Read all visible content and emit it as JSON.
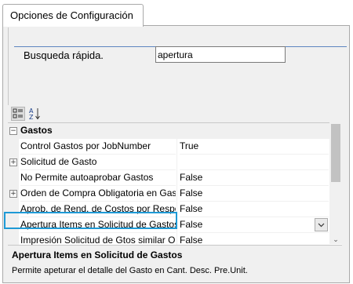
{
  "tab": {
    "title": "Opciones de Configuración"
  },
  "search": {
    "label": "Busqueda rápida.",
    "value": "apertura"
  },
  "toolbar": {
    "categorized_icon": "categorized-view-icon",
    "alphabetical_icon": "alphabetical-sort-icon"
  },
  "grid": {
    "category": "Gastos",
    "rows": [
      {
        "name": "Control Gastos por JobNumber",
        "value": "True",
        "expandable": false
      },
      {
        "name": "Solicitud de Gasto",
        "value": "",
        "expandable": true
      },
      {
        "name": "No Permite autoaprobar Gastos",
        "value": "False",
        "expandable": false
      },
      {
        "name": "Orden de Compra Obligatoria en Gastos",
        "value": "False",
        "expandable": true
      },
      {
        "name": "Aprob. de Rend. de Costos por Responsable",
        "value": "False",
        "expandable": false
      },
      {
        "name": "Apertura Items en Solicitud de Gastos",
        "value": "False",
        "expandable": false
      },
      {
        "name": "Impresión Solicitud de Gtos similar Ord. de Compra",
        "value": "False",
        "expandable": false
      }
    ]
  },
  "help": {
    "title": "Apertura Items en Solicitud de Gastos",
    "description": "Permite apeturar el detalle del Gasto en Cant. Desc. Pre.Unit."
  },
  "colors": {
    "accent_line": "#5d86c0",
    "selection_highlight": "#1e9ad6"
  }
}
